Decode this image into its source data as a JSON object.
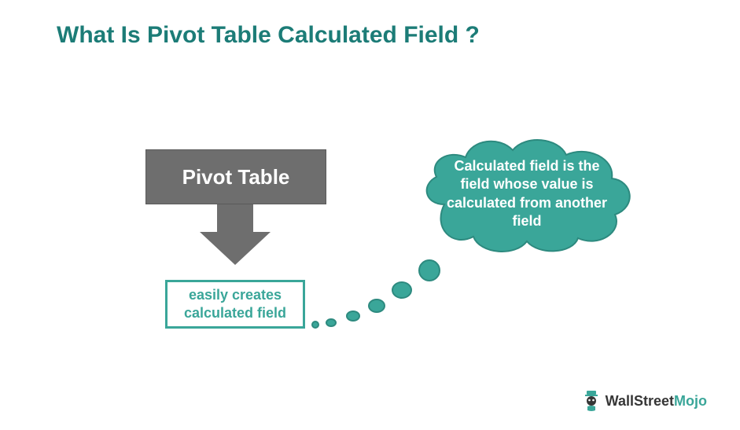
{
  "title": "What Is Pivot Table Calculated Field ?",
  "pivot_box": "Pivot Table",
  "result_box": "easily creates calculated field",
  "cloud_text": "Calculated field is the field whose value is calculated from another field",
  "logo": {
    "wall": "WallStreet",
    "mojo": "Mojo"
  },
  "colors": {
    "teal": "#3aa699",
    "teal_dark": "#1c7c77",
    "gray": "#6e6e6e"
  }
}
